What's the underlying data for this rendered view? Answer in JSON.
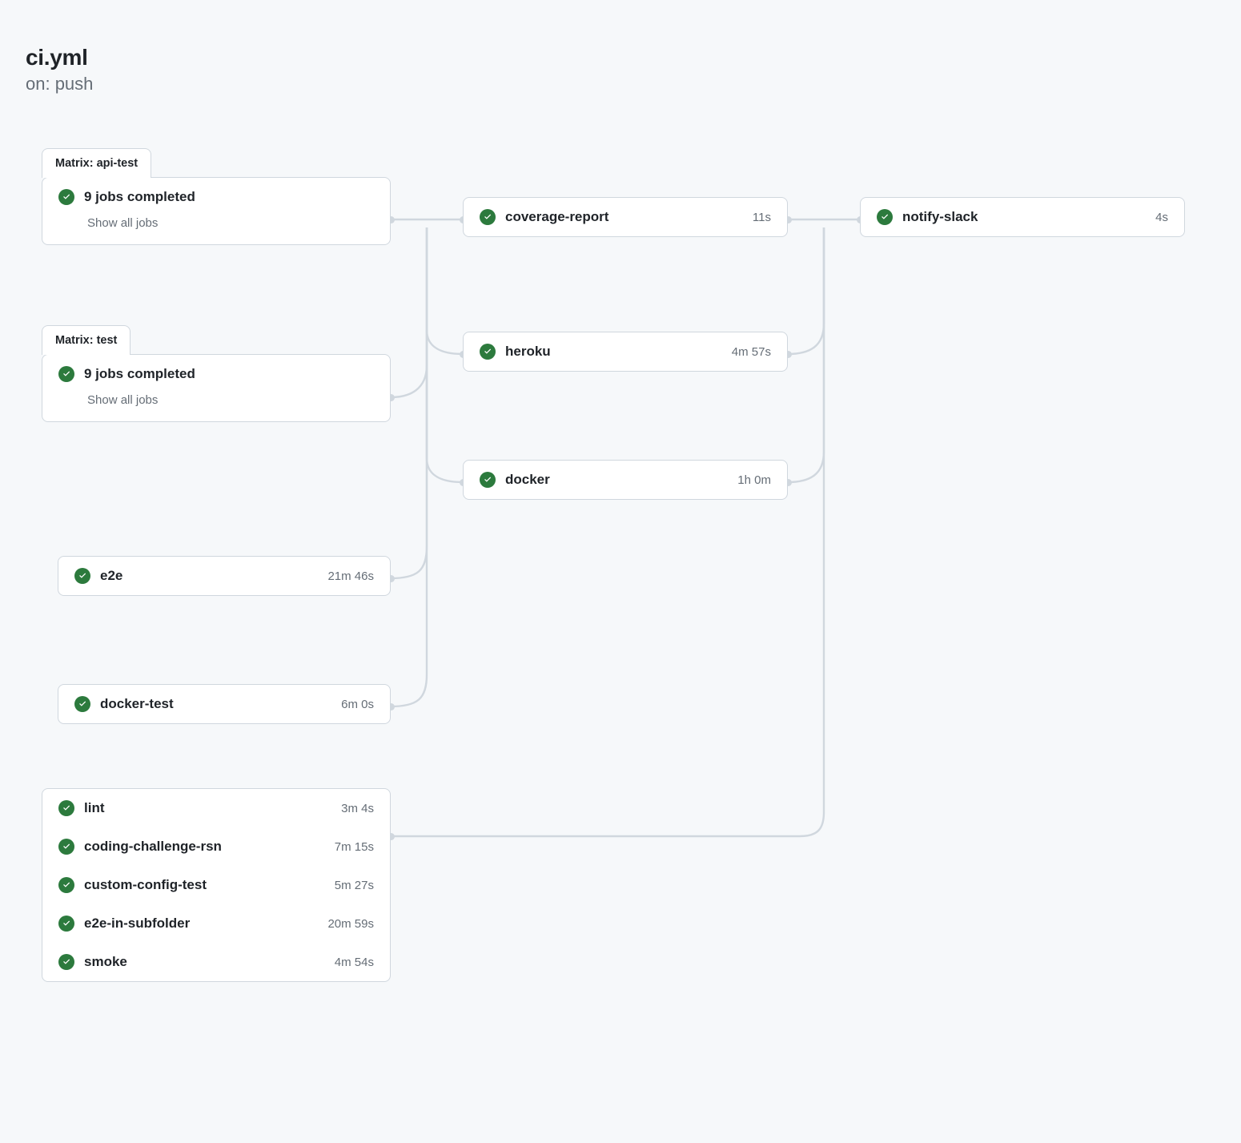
{
  "header": {
    "title": "ci.yml",
    "subtitle": "on: push"
  },
  "matrix_api_test": {
    "tab": "Matrix: api-test",
    "summary": "9 jobs completed",
    "show_all": "Show all jobs"
  },
  "matrix_test": {
    "tab": "Matrix: test",
    "summary": "9 jobs completed",
    "show_all": "Show all jobs"
  },
  "jobs": {
    "e2e": {
      "name": "e2e",
      "time": "21m 46s"
    },
    "docker_test": {
      "name": "docker-test",
      "time": "6m 0s"
    },
    "coverage": {
      "name": "coverage-report",
      "time": "11s"
    },
    "heroku": {
      "name": "heroku",
      "time": "4m 57s"
    },
    "docker": {
      "name": "docker",
      "time": "1h 0m"
    },
    "notify_slack": {
      "name": "notify-slack",
      "time": "4s"
    },
    "lint": {
      "name": "lint",
      "time": "3m 4s"
    },
    "coding": {
      "name": "coding-challenge-rsn",
      "time": "7m 15s"
    },
    "custom_config": {
      "name": "custom-config-test",
      "time": "5m 27s"
    },
    "e2e_subfolder": {
      "name": "e2e-in-subfolder",
      "time": "20m 59s"
    },
    "smoke": {
      "name": "smoke",
      "time": "4m 54s"
    }
  },
  "icons": {
    "success": "success-check-icon"
  }
}
